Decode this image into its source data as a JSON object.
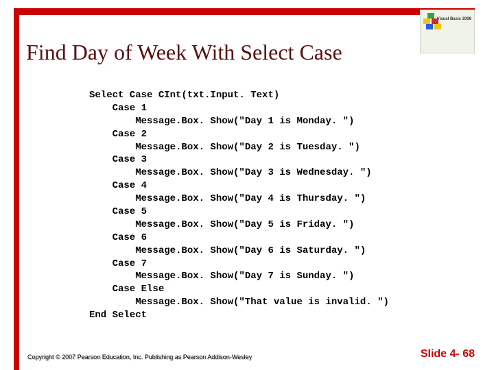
{
  "title": "Find Day of Week With Select Case",
  "code_lines": [
    "Select Case CInt(txt.Input. Text)",
    "    Case 1",
    "        Message.Box. Show(\"Day 1 is Monday. \")",
    "    Case 2",
    "        Message.Box. Show(\"Day 2 is Tuesday. \")",
    "    Case 3",
    "        Message.Box. Show(\"Day 3 is Wednesday. \")",
    "    Case 4",
    "        Message.Box. Show(\"Day 4 is Thursday. \")",
    "    Case 5",
    "        Message.Box. Show(\"Day 5 is Friday. \")",
    "    Case 6",
    "        Message.Box. Show(\"Day 6 is Saturday. \")",
    "    Case 7",
    "        Message.Box. Show(\"Day 7 is Sunday. \")",
    "    Case Else",
    "        Message.Box. Show(\"That value is invalid. \")",
    "End Select"
  ],
  "copyright": "Copyright © 2007 Pearson Education, Inc. Publishing as Pearson Addison-Wesley",
  "slide_number": "Slide 4- 68",
  "logo_text": "Visual Basic\n2008"
}
